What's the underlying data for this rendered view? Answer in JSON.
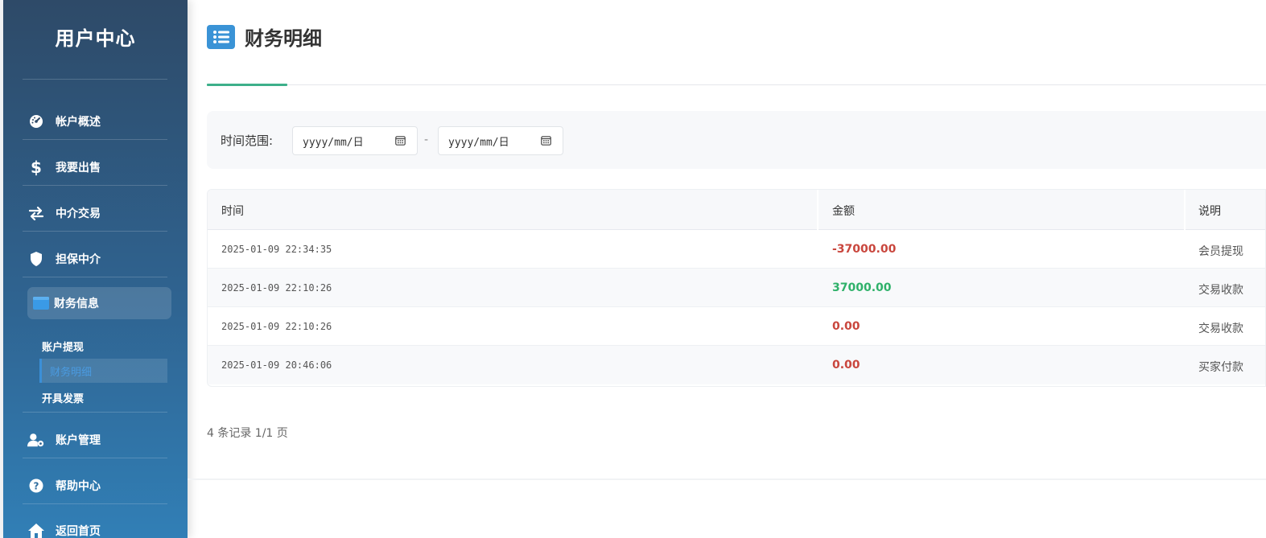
{
  "sidebar": {
    "title": "用户中心",
    "items": [
      {
        "label": "帐户概述",
        "icon": "dashboard-icon"
      },
      {
        "label": "我要出售",
        "icon": "dollar-icon"
      },
      {
        "label": "中介交易",
        "icon": "swap-icon"
      },
      {
        "label": "担保中介",
        "icon": "shield-icon"
      },
      {
        "label": "财务信息",
        "icon": "wallet-icon"
      },
      {
        "label": "账户管理",
        "icon": "user-gear-icon"
      },
      {
        "label": "帮助中心",
        "icon": "question-icon"
      },
      {
        "label": "返回首页",
        "icon": "home-icon"
      }
    ],
    "sub_items": [
      {
        "label": "账户提现"
      },
      {
        "label": "财务明细"
      },
      {
        "label": "开具发票"
      }
    ]
  },
  "page": {
    "title": "财务明细"
  },
  "filter": {
    "label": "时间范围:",
    "start_placeholder": "yyyy/mm/日",
    "end_placeholder": "yyyy/mm/日",
    "separator": "-"
  },
  "table": {
    "headers": [
      "时间",
      "金额",
      "说明"
    ],
    "rows": [
      {
        "time": "2025-01-09 22:34:35",
        "amount": "-37000.00",
        "desc": "会员提现"
      },
      {
        "time": "2025-01-09 22:10:26",
        "amount": "37000.00",
        "desc": "交易收款"
      },
      {
        "time": "2025-01-09 22:10:26",
        "amount": "0.00",
        "desc": "交易收款"
      },
      {
        "time": "2025-01-09 20:46:06",
        "amount": "0.00",
        "desc": "买家付款"
      }
    ]
  },
  "pagination": {
    "summary": "4 条记录 1/1 页"
  },
  "colors": {
    "sidebar_top": "#2e4a68",
    "sidebar_bottom": "#317fb6",
    "accent_green": "#3db08a",
    "negative": "#c9463d",
    "positive": "#2fb16a"
  }
}
